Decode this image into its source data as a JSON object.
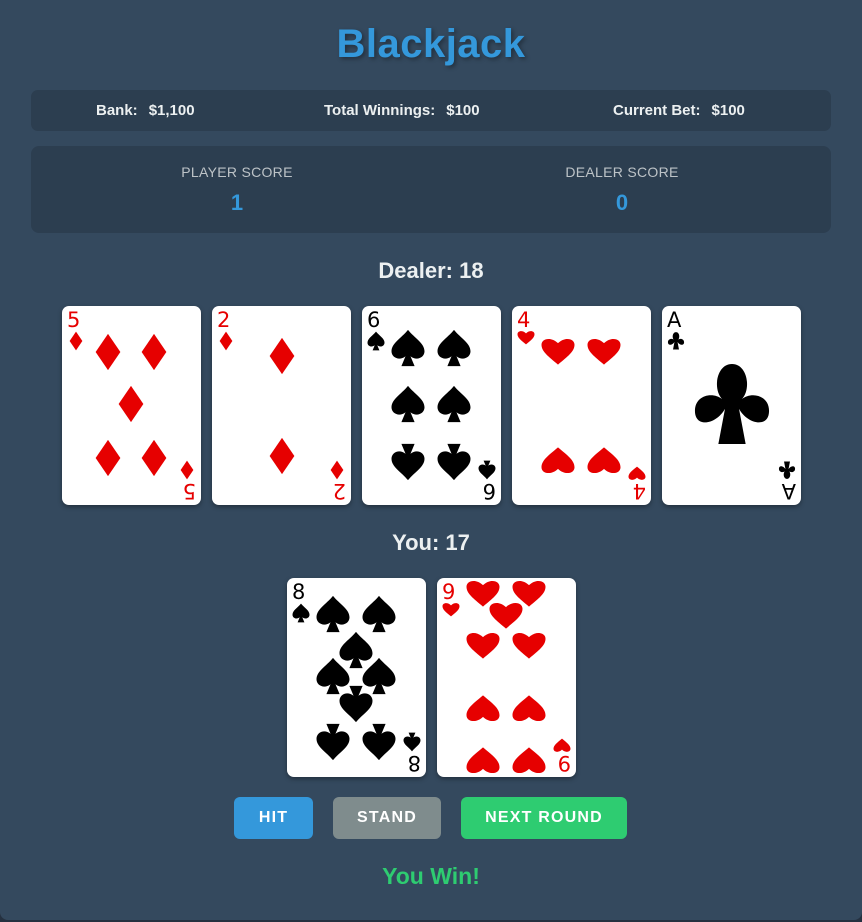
{
  "title": "Blackjack",
  "stats": {
    "bank_label": "Bank:",
    "bank_value": "$1,100",
    "winnings_label": "Total Winnings:",
    "winnings_value": "$100",
    "bet_label": "Current Bet:",
    "bet_value": "$100"
  },
  "scores": {
    "player_label": "PLAYER SCORE",
    "player_value": "1",
    "dealer_label": "DEALER SCORE",
    "dealer_value": "0"
  },
  "dealer": {
    "title": "Dealer: 18",
    "cards": [
      {
        "rank": "5",
        "suit": "diamonds"
      },
      {
        "rank": "2",
        "suit": "diamonds"
      },
      {
        "rank": "6",
        "suit": "spades"
      },
      {
        "rank": "4",
        "suit": "hearts"
      },
      {
        "rank": "A",
        "suit": "clubs"
      }
    ]
  },
  "player": {
    "title": "You: 17",
    "cards": [
      {
        "rank": "8",
        "suit": "spades"
      },
      {
        "rank": "9",
        "suit": "hearts"
      }
    ]
  },
  "buttons": {
    "hit": "HIT",
    "stand": "STAND",
    "next_round": "NEXT ROUND"
  },
  "message": "You Win!",
  "colors": {
    "background": "#34495e",
    "panel": "#2c3e50",
    "accent": "#3498db",
    "success": "#2ecc71",
    "neutral": "#7f8c8d",
    "red_suit": "#e60000",
    "black_suit": "#000000"
  }
}
